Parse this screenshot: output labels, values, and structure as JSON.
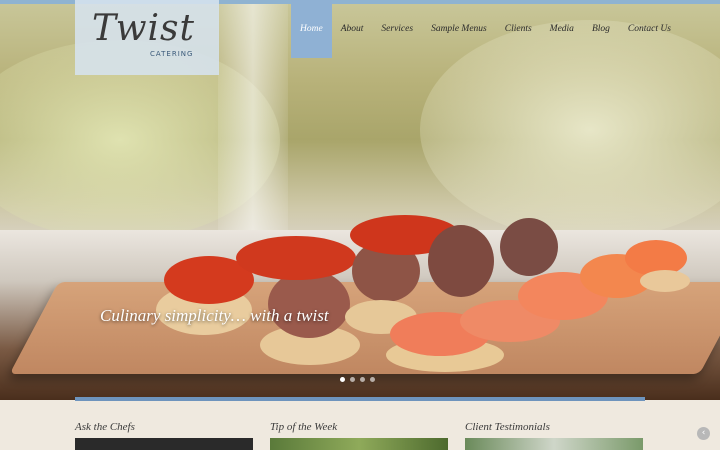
{
  "logo": {
    "word": "Twist",
    "sub": "CATERING"
  },
  "nav": {
    "items": [
      "Home",
      "About",
      "Services",
      "Sample Menus",
      "Clients",
      "Media",
      "Blog",
      "Contact Us"
    ],
    "active_index": 0
  },
  "hero": {
    "tagline": "Culinary simplicity… with a twist",
    "slide_count": 4,
    "active_slide": 0
  },
  "sections": {
    "ask_chefs": "Ask the Chefs",
    "tip": "Tip of the Week",
    "testimonials": "Client Testimonials"
  },
  "icons": {
    "corner": "chevron-left-icon"
  },
  "colors": {
    "accent": "#8fb1d4",
    "strip": "#6e94bd",
    "background": "#efe9df"
  }
}
